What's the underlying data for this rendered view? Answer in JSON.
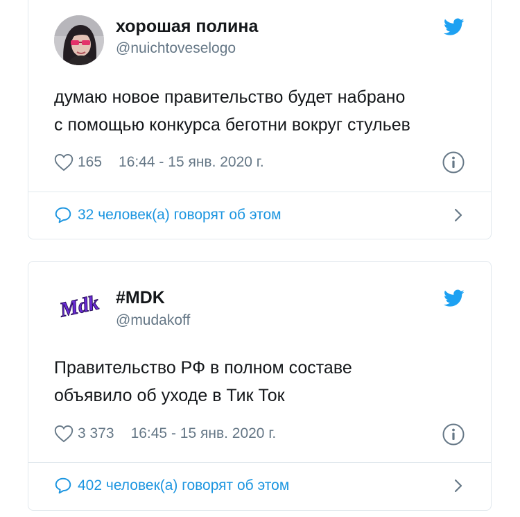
{
  "tweets": [
    {
      "author_name": "хорошая полина",
      "handle": "@nuichtoveselogo",
      "text_line1": "думаю новое правительство будет набрано",
      "text_line2": "с помощью конкурса беготни вокруг стульев",
      "likes": "165",
      "timestamp": "16:44 - 15 янв. 2020 г.",
      "replies_label": "32 человек(а) говорят об этом",
      "avatar_icon": "user-photo-avatar"
    },
    {
      "author_name": "#MDK",
      "handle": "@mudakoff",
      "text_line1": "Правительство РФ в полном составе",
      "text_line2": "объявило об уходе в Тик Ток",
      "likes": "3 373",
      "timestamp": "16:45 - 15 янв. 2020 г.",
      "replies_label": "402 человек(а) говорят об этом",
      "avatar_logo_text": "Mdk",
      "avatar_icon": "mdk-logo"
    }
  ],
  "colors": {
    "text": "#14171a",
    "secondary": "#657786",
    "link": "#1b95e0",
    "twitter_blue": "#1da1f2",
    "border": "#e1e8ed",
    "mdk_purple": "#6a2bd6"
  }
}
